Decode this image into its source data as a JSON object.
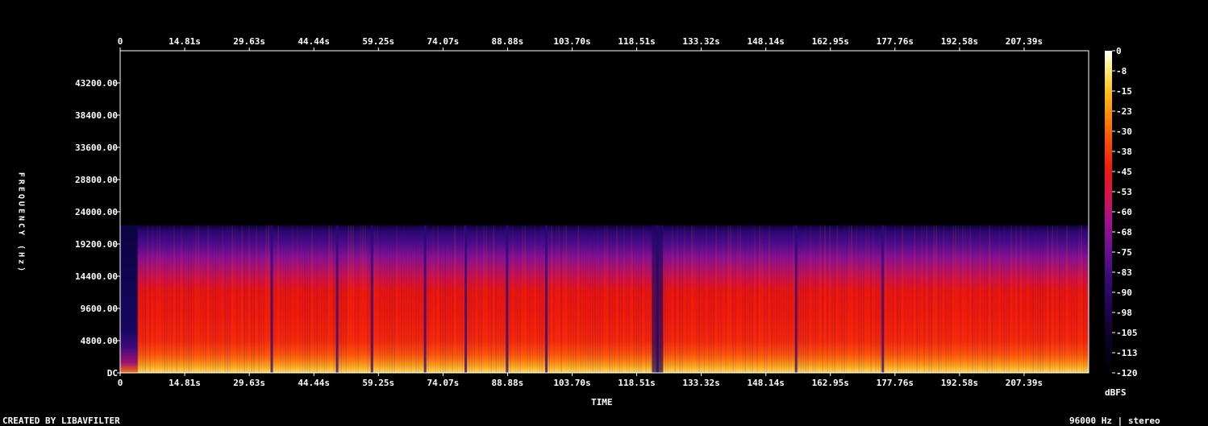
{
  "chart_data": {
    "type": "heatmap",
    "xlabel": "TIME",
    "ylabel": "FREQUENCY (Hz)",
    "x_ticks": [
      "0",
      "14.81s",
      "29.63s",
      "44.44s",
      "59.25s",
      "74.07s",
      "88.88s",
      "103.70s",
      "118.51s",
      "133.32s",
      "148.14s",
      "162.95s",
      "177.76s",
      "192.58s",
      "207.39s"
    ],
    "x_tick_values": [
      0,
      14.81,
      29.63,
      44.44,
      59.25,
      74.07,
      88.88,
      103.7,
      118.51,
      133.32,
      148.14,
      162.95,
      177.76,
      192.58,
      207.39
    ],
    "xlim": [
      0,
      222.2
    ],
    "y_ticks": [
      "43200.00",
      "38400.00",
      "33600.00",
      "28800.00",
      "24000.00",
      "19200.00",
      "14400.00",
      "9600.00",
      "4800.00",
      "DC"
    ],
    "y_tick_values": [
      43200,
      38400,
      33600,
      28800,
      24000,
      19200,
      14400,
      9600,
      4800,
      0
    ],
    "ylim": [
      0,
      48000
    ],
    "content_cutoff_hz": 22000,
    "colorbar": {
      "label": "dBFS",
      "ticks": [
        "0",
        "-8",
        "-15",
        "-23",
        "-30",
        "-38",
        "-45",
        "-53",
        "-60",
        "-68",
        "-75",
        "-83",
        "-90",
        "-98",
        "-105",
        "-113",
        "-120"
      ],
      "range": [
        -120,
        0
      ]
    },
    "grid": false
  },
  "footer": {
    "left": "CREATED BY LIBAVFILTER",
    "right": "96000 Hz | stereo"
  },
  "colors": {
    "background": "#000000",
    "axis": "#ffffff",
    "palette": [
      "#000000",
      "#0b0224",
      "#1f0552",
      "#3a0a7a",
      "#5c0f8e",
      "#85119a",
      "#b4108a",
      "#d9124f",
      "#f0180f",
      "#fb4d06",
      "#fd8a0a",
      "#fec51c",
      "#fff08a",
      "#ffffff"
    ]
  }
}
